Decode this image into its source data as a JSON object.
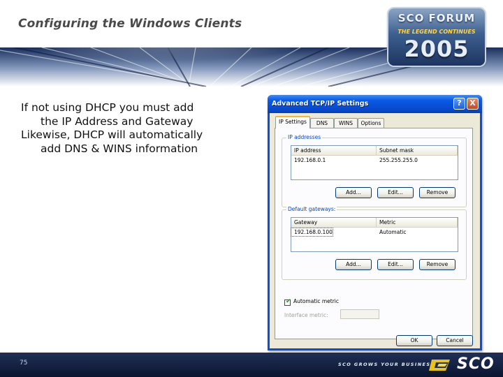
{
  "slide": {
    "title": "Configuring the Windows Clients",
    "page_number": "75",
    "bullets": [
      {
        "line1": "If not using DHCP you must add",
        "line2": "the IP Address and Gateway"
      },
      {
        "line1": "Likewise, DHCP will automatically",
        "line2": "add DNS & WINS information"
      }
    ]
  },
  "logo": {
    "top": "SCO FORUM",
    "subtitle": "THE LEGEND CONTINUES",
    "year": "2005"
  },
  "footer": {
    "tagline": "SCO GROWS YOUR BUSINESS",
    "brand": "SCO"
  },
  "dialog": {
    "title": "Advanced TCP/IP Settings",
    "help_label": "?",
    "close_label": "X",
    "tabs": [
      "IP Settings",
      "DNS",
      "WINS",
      "Options"
    ],
    "ip_group": {
      "label": "IP addresses",
      "columns": [
        "IP address",
        "Subnet mask"
      ],
      "rows": [
        {
          "ip": "192.168.0.1",
          "mask": "255.255.255.0"
        }
      ],
      "buttons": {
        "add": "Add...",
        "edit": "Edit...",
        "remove": "Remove"
      }
    },
    "gateway_group": {
      "label": "Default gateways:",
      "columns": [
        "Gateway",
        "Metric"
      ],
      "rows": [
        {
          "gateway": "192.168.0.100",
          "metric": "Automatic"
        }
      ],
      "buttons": {
        "add": "Add...",
        "edit": "Edit...",
        "remove": "Remove"
      }
    },
    "automatic_metric": {
      "label": "Automatic metric",
      "checked": true
    },
    "interface_metric_label": "Interface metric:",
    "ok_label": "OK",
    "cancel_label": "Cancel"
  }
}
